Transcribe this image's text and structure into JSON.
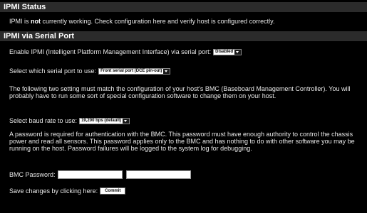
{
  "status_section": {
    "title": "IPMI Status",
    "message_before": "IPMI is ",
    "message_bold": "not",
    "message_after": " currently working. Check configuration here and verify host is configured correctly."
  },
  "serial_section": {
    "title": "IPMI via Serial Port",
    "enable_label": "Enable IPMI (Intelligent Platform Management Interface) via serial port:",
    "enable_value": "Disabled",
    "port_label": "Select which serial port to use:",
    "port_value": "Front serial port (DCE pin-out)",
    "bmc_note": "The following two setting must match the configuration of your host's BMC (Baseboard Management Controller). You will probably have to run some sort of special configuration software to change them on your host.",
    "baud_label": "Select baud rate to use:",
    "baud_value": "19,200 bps (default)",
    "password_note": "A password is required for authentication with the BMC. This password must have enough authority to control the chassis power and read all sensors. This password applies only to the BMC and has nothing to do with other software you may be running on the host. Password failures will be logged to the system log for debugging.",
    "password_label": "BMC Password:",
    "password_value": "",
    "password_confirm_value": "",
    "save_label": "Save changes by clicking here:",
    "commit_label": "Commit"
  }
}
